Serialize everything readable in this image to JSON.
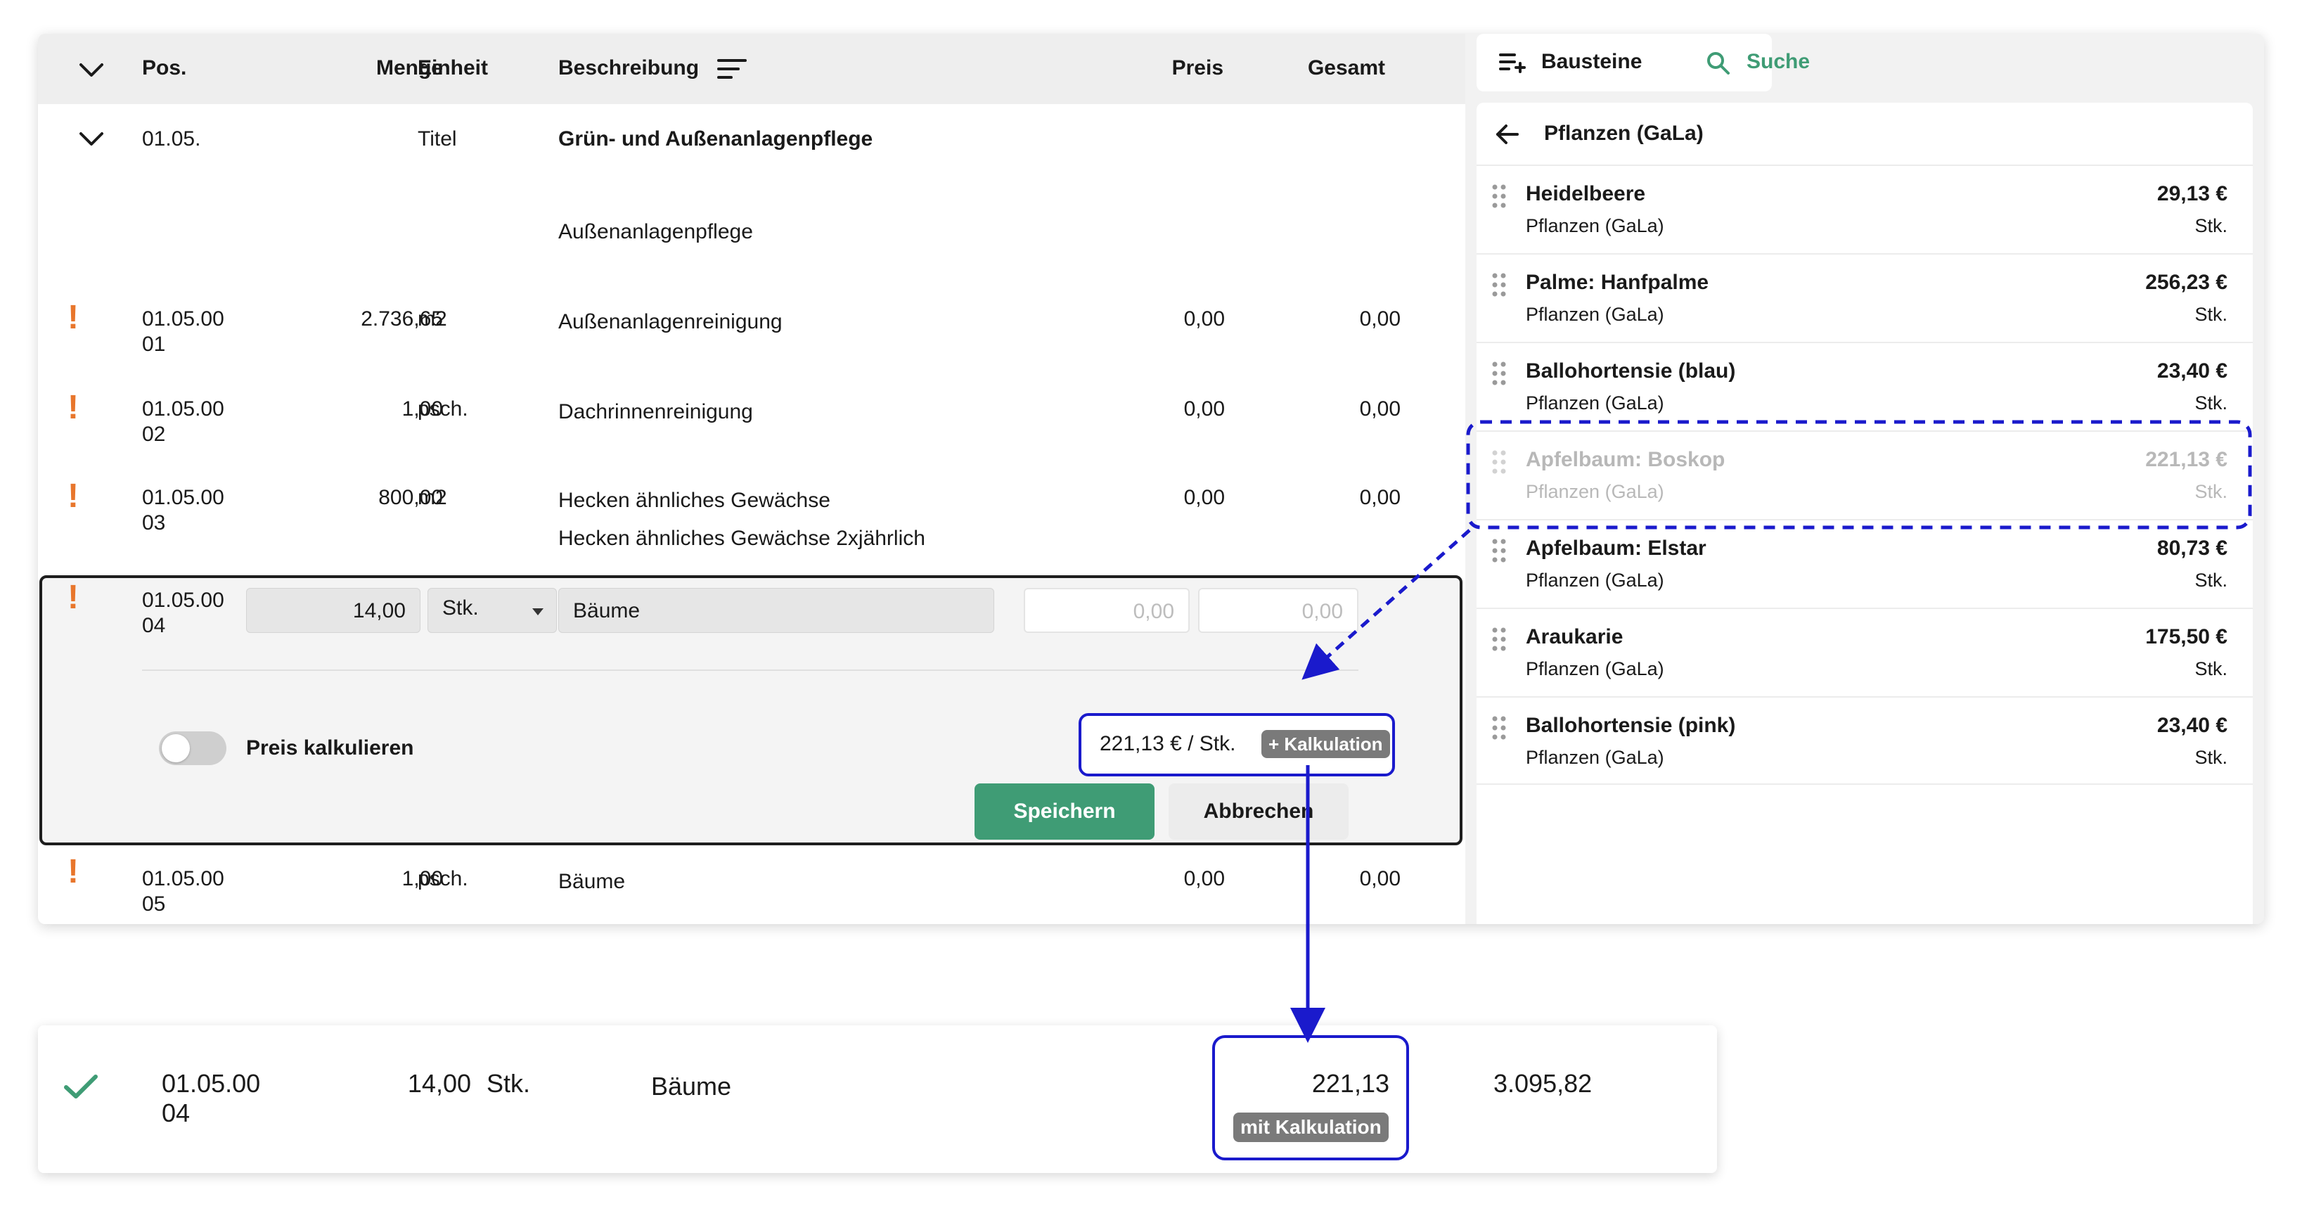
{
  "table": {
    "header": {
      "pos": "Pos.",
      "menge": "Menge",
      "einheit": "Einheit",
      "beschreibung": "Beschreibung",
      "preis": "Preis",
      "gesamt": "Gesamt"
    },
    "title_row": {
      "pos": "01.05.",
      "einheit": "Titel",
      "beschreibung": "Grün- und Außenanlagenpflege",
      "subtitle": "Außenanlagenpflege"
    },
    "rows": [
      {
        "pos_a": "01.05.00",
        "pos_b": "01",
        "menge": "2.736,65",
        "einheit": "m2",
        "beschreibung": "Außenanlagenreinigung",
        "beschreibung2": "",
        "preis": "0,00",
        "gesamt": "0,00",
        "warning": "!"
      },
      {
        "pos_a": "01.05.00",
        "pos_b": "02",
        "menge": "1,00",
        "einheit": "psch.",
        "beschreibung": "Dachrinnenreinigung",
        "beschreibung2": "",
        "preis": "0,00",
        "gesamt": "0,00",
        "warning": "!"
      },
      {
        "pos_a": "01.05.00",
        "pos_b": "03",
        "menge": "800,00",
        "einheit": "m2",
        "beschreibung": "Hecken ähnliches Gewächse",
        "beschreibung2": "Hecken ähnliches Gewächse 2xjährlich",
        "preis": "0,00",
        "gesamt": "0,00",
        "warning": "!"
      }
    ],
    "edit_row": {
      "pos_a": "01.05.00",
      "pos_b": "04",
      "warning": "!",
      "menge": "14,00",
      "einheit": "Stk.",
      "beschreibung": "Bäume",
      "preis_placeholder": "0,00",
      "gesamt_placeholder": "0,00",
      "toggle_label": "Preis kalkulieren",
      "toggle_on": false,
      "dropped_price": "221,13 € / Stk.",
      "kalkulation_badge": "+ Kalkulation",
      "save_label": "Speichern",
      "cancel_label": "Abbrechen"
    },
    "last_row": {
      "pos_a": "01.05.00",
      "pos_b": "05",
      "menge": "1,00",
      "einheit": "psch.",
      "beschreibung": "Bäume",
      "preis": "0,00",
      "gesamt": "0,00",
      "warning": "!"
    }
  },
  "sidebar": {
    "tabs": {
      "bausteine": "Bausteine",
      "suche": "Suche"
    },
    "back_title": "Pflanzen (GaLa)",
    "items": [
      {
        "name": "Heidelbeere",
        "category": "Pflanzen (GaLa)",
        "price": "29,13 €",
        "unit": "Stk.",
        "dragging": false
      },
      {
        "name": "Palme: Hanfpalme",
        "category": "Pflanzen (GaLa)",
        "price": "256,23 €",
        "unit": "Stk.",
        "dragging": false
      },
      {
        "name": "Ballohortensie (blau)",
        "category": "Pflanzen (GaLa)",
        "price": "23,40 €",
        "unit": "Stk.",
        "dragging": false
      },
      {
        "name": "Apfelbaum: Boskop",
        "category": "Pflanzen (GaLa)",
        "price": "221,13 €",
        "unit": "Stk.",
        "dragging": true
      },
      {
        "name": "Apfelbaum: Elstar",
        "category": "Pflanzen (GaLa)",
        "price": "80,73 €",
        "unit": "Stk.",
        "dragging": false
      },
      {
        "name": "Araukarie",
        "category": "Pflanzen (GaLa)",
        "price": "175,50 €",
        "unit": "Stk.",
        "dragging": false
      },
      {
        "name": "Ballohortensie (pink)",
        "category": "Pflanzen (GaLa)",
        "price": "23,40 €",
        "unit": "Stk.",
        "dragging": false
      }
    ]
  },
  "result": {
    "status_icon": "check-icon",
    "pos_a": "01.05.00",
    "pos_b": "04",
    "menge": "14,00",
    "einheit": "Stk.",
    "beschreibung": "Bäume",
    "preis": "221,13",
    "badge": "mit Kalkulation",
    "gesamt": "3.095,82"
  },
  "colors": {
    "accent_green": "#3f9c75",
    "warning_orange": "#e8762c",
    "annotation_blue": "#1a1acc",
    "badge_grey": "#7a7a7a"
  }
}
